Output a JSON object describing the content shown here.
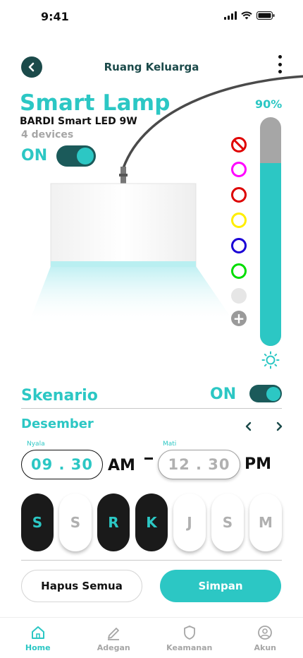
{
  "status_bar": {
    "time": "9:41"
  },
  "header": {
    "title": "Ruang Keluarga"
  },
  "device": {
    "name": "Smart Lamp",
    "model": "BARDI Smart LED 9W",
    "count": "4 devices",
    "power_label": "ON",
    "power_on": true
  },
  "colors": {
    "options": [
      "#ff00ff",
      "#dd0000",
      "#ffee00",
      "#1a00d6",
      "#00dd00"
    ],
    "accent": "#2cc7c4",
    "dark": "#1b4a4a"
  },
  "brightness": {
    "label": "90%",
    "value": 0.9
  },
  "schedule": {
    "title": "Skenario",
    "toggle_label": "ON",
    "enabled": true,
    "month": "Desember",
    "on_caption": "Nyala",
    "on_time": "09 . 30",
    "on_period": "AM",
    "off_caption": "Mati",
    "off_time": "12 . 30",
    "off_period": "PM",
    "days": [
      {
        "label": "S",
        "active": true
      },
      {
        "label": "S",
        "active": false
      },
      {
        "label": "R",
        "active": true
      },
      {
        "label": "K",
        "active": true
      },
      {
        "label": "J",
        "active": false
      },
      {
        "label": "S",
        "active": false
      },
      {
        "label": "M",
        "active": false
      }
    ]
  },
  "actions": {
    "clear": "Hapus Semua",
    "save": "Simpan"
  },
  "nav": {
    "items": [
      {
        "label": "Home",
        "icon": "home-icon",
        "active": true
      },
      {
        "label": "Adegan",
        "icon": "pencil-icon",
        "active": false
      },
      {
        "label": "Keamanan",
        "icon": "shield-icon",
        "active": false
      },
      {
        "label": "Akun",
        "icon": "user-icon",
        "active": false
      }
    ]
  }
}
